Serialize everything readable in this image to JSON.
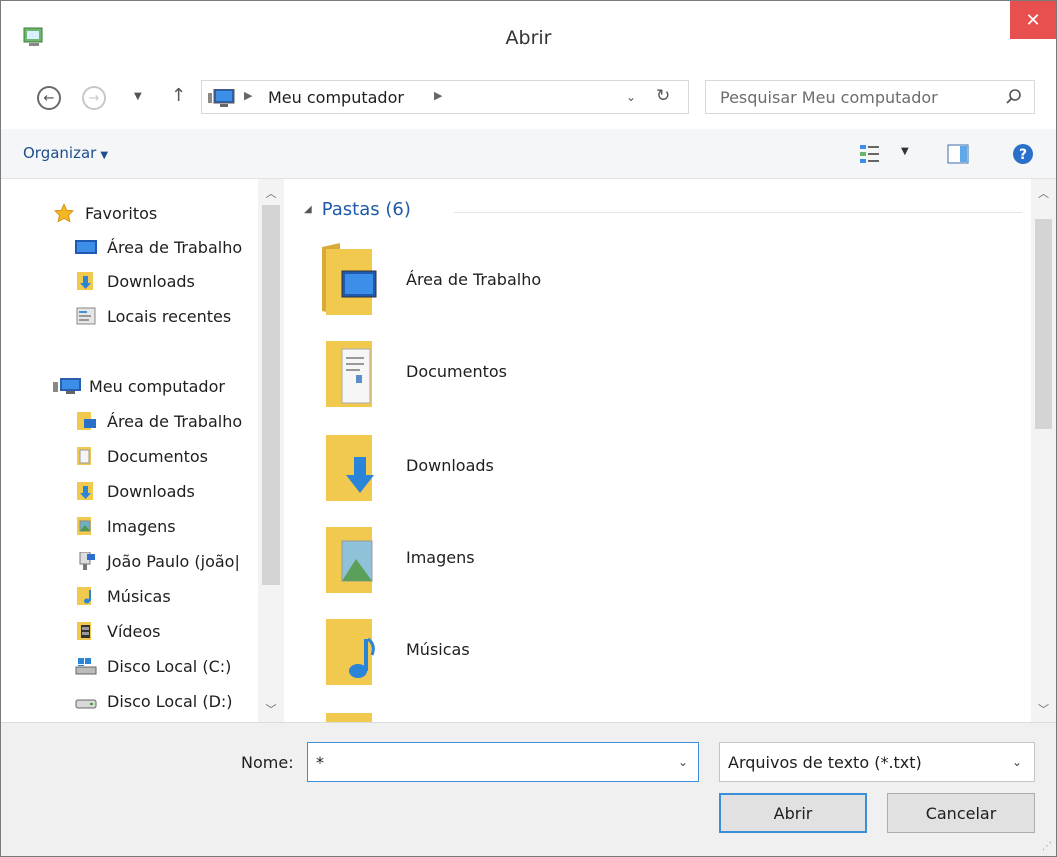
{
  "window": {
    "title": "Abrir",
    "close_label": "✕"
  },
  "navigation": {
    "address_path": "Meu computador",
    "search_placeholder": "Pesquisar Meu computador"
  },
  "toolbar": {
    "organize_label": "Organizar"
  },
  "nav_pane": {
    "favorites_label": "Favoritos",
    "favorites_items": [
      {
        "label": "Área de Trabalho",
        "icon": "desktop-icon"
      },
      {
        "label": "Downloads",
        "icon": "downloads-folder-icon"
      },
      {
        "label": "Locais recentes",
        "icon": "recent-places-icon"
      }
    ],
    "computer_label": "Meu computador",
    "computer_items": [
      {
        "label": "Área de Trabalho",
        "icon": "desktop-folder-icon"
      },
      {
        "label": "Documentos",
        "icon": "documents-folder-icon"
      },
      {
        "label": "Downloads",
        "icon": "downloads-folder-icon"
      },
      {
        "label": "Imagens",
        "icon": "pictures-folder-icon"
      },
      {
        "label": "João Paulo (joão|",
        "icon": "network-drive-icon"
      },
      {
        "label": "Músicas",
        "icon": "music-folder-icon"
      },
      {
        "label": "Vídeos",
        "icon": "videos-folder-icon"
      },
      {
        "label": "Disco Local (C:)",
        "icon": "system-drive-icon"
      },
      {
        "label": "Disco Local (D:)",
        "icon": "local-drive-icon"
      }
    ]
  },
  "content": {
    "group_header": "Pastas (6)",
    "folders": [
      {
        "label": "Área de Trabalho",
        "icon": "desktop-folder-icon"
      },
      {
        "label": "Documentos",
        "icon": "documents-folder-icon"
      },
      {
        "label": "Downloads",
        "icon": "downloads-folder-icon"
      },
      {
        "label": "Imagens",
        "icon": "pictures-folder-icon"
      },
      {
        "label": "Músicas",
        "icon": "music-folder-icon"
      }
    ]
  },
  "bottom": {
    "name_label": "Nome:",
    "name_value": "*",
    "file_type_value": "Arquivos de texto (*.txt)",
    "open_button_label": "Abrir",
    "cancel_button_label": "Cancelar"
  },
  "colors": {
    "close_red": "#e8504f",
    "accent_blue": "#3c8ed6",
    "link_blue": "#1e4e8c",
    "folder_yellow": "#f2c94f"
  }
}
